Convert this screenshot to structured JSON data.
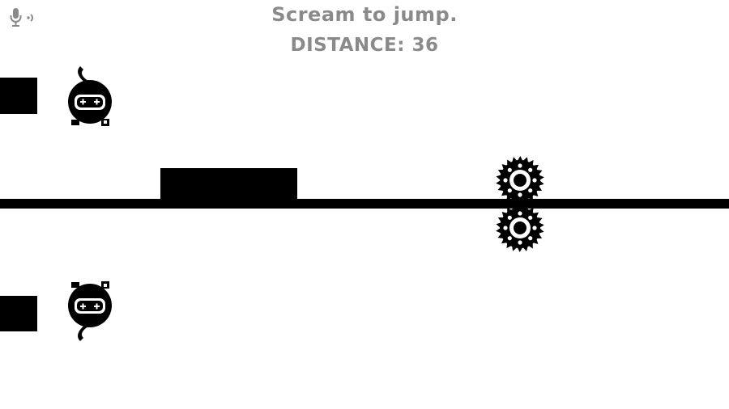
{
  "hud": {
    "instruction": "Scream to jump.",
    "distance_label": "DISTANCE:",
    "distance_value": "36"
  },
  "icons": {
    "mic": "microphone-icon",
    "player": "ninja-gamepad-icon",
    "hazard": "saw-blade-icon"
  },
  "colors": {
    "text": "#8a8a8a",
    "ink": "#000000",
    "background": "#ffffff"
  }
}
